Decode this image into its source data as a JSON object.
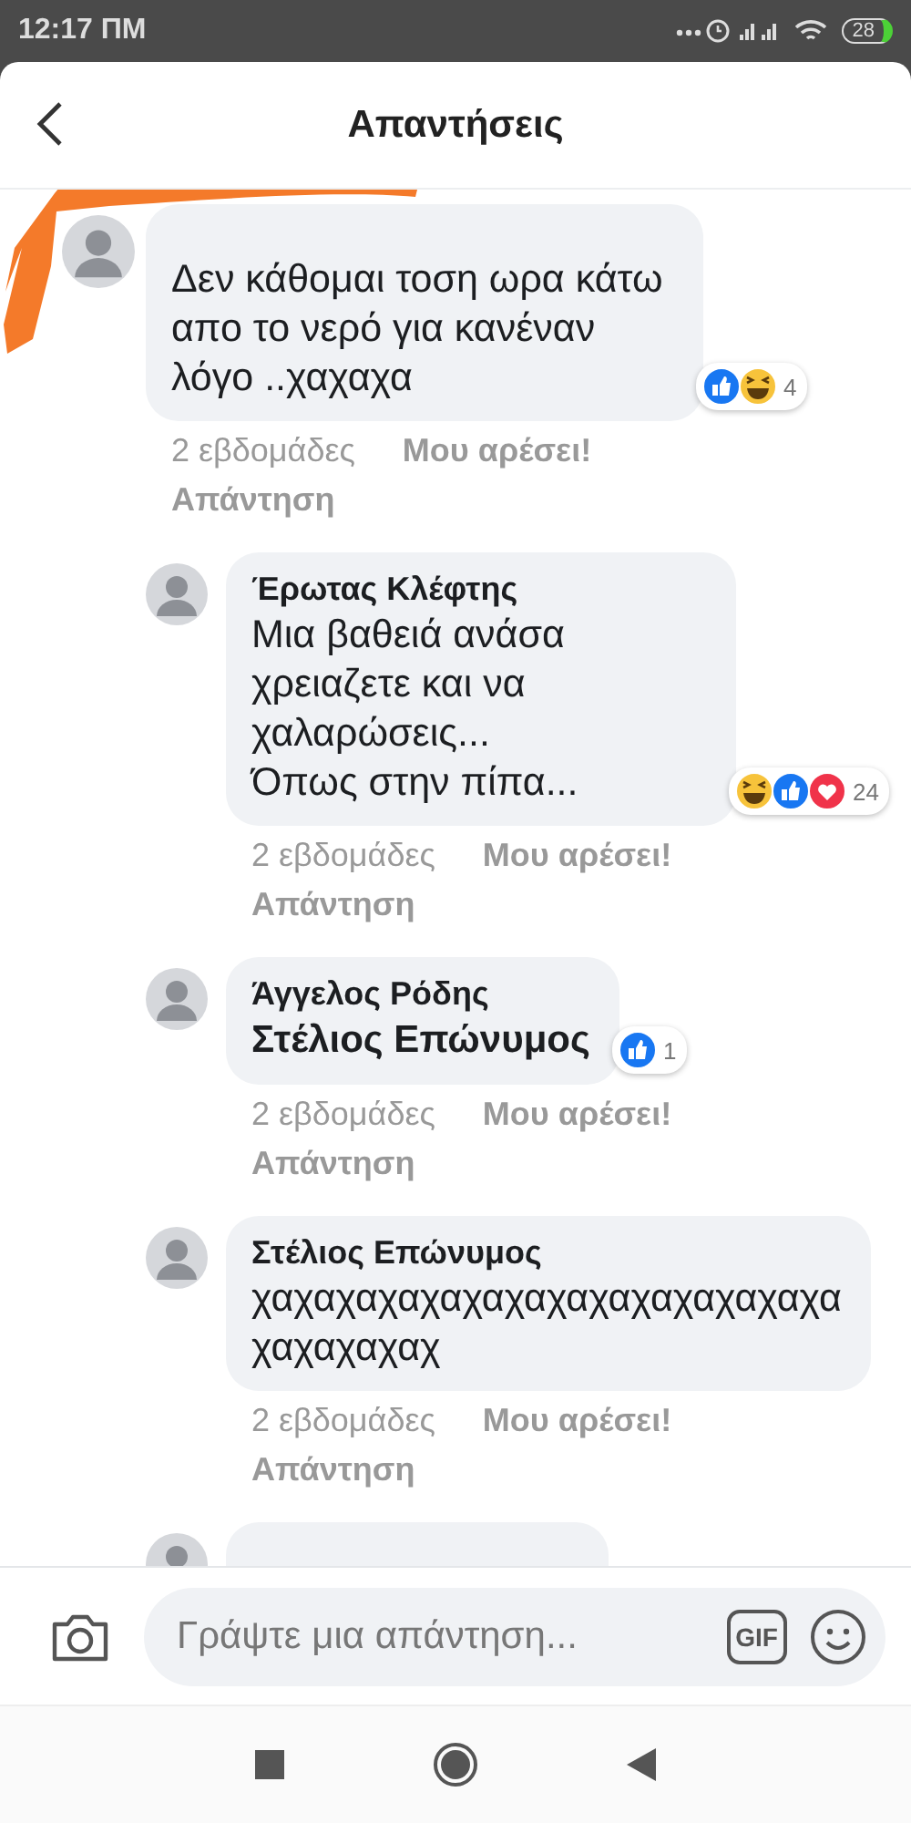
{
  "status_bar": {
    "time": "12:17 ΠΜ",
    "battery": "28"
  },
  "header": {
    "title": "Απαντήσεις"
  },
  "comments": [
    {
      "body": "Δεν κάθομαι τοση ωρα κάτω απο το νερό για κανέναν λόγο ..χαχαχα",
      "reactions": {
        "items": [
          {
            "kind": "like"
          },
          {
            "kind": "haha"
          }
        ],
        "count": "4"
      },
      "time": "2 εβδομάδες",
      "like_label": "Μου αρέσει!",
      "reply_label": "Απάντηση",
      "redacted": true,
      "replies": [
        {
          "name": "Έρωτας Κλέφτης",
          "body": "Μια βαθειά ανάσα χρειαζετε και να χαλαρώσεις...\nΌπως στην πίπα...",
          "reactions": {
            "items": [
              {
                "kind": "haha"
              },
              {
                "kind": "like"
              },
              {
                "kind": "love"
              }
            ],
            "count": "24"
          },
          "time": "2 εβδομάδες",
          "like_label": "Μου αρέσει!",
          "reply_label": "Απάντηση"
        },
        {
          "name": "Άγγελος Ρόδης",
          "tagged_name": "Στέλιος Επώνυμος",
          "reactions": {
            "items": [
              {
                "kind": "like"
              }
            ],
            "count": "1"
          },
          "time": "2 εβδομάδες",
          "like_label": "Μου αρέσει!",
          "reply_label": "Απάντηση"
        },
        {
          "name": "Στέλιος Επώνυμος",
          "body": "χαχαχαχαχαχαχαχαχαχαχαχαχαχα χαχαχαχαχ",
          "time": "2 εβδομάδες",
          "like_label": "Μου αρέσει!",
          "reply_label": "Απάντηση"
        },
        {
          "cut_off": true
        }
      ]
    }
  ],
  "composer": {
    "placeholder": "Γράψτε μια απάντηση...",
    "gif_label": "GIF"
  }
}
